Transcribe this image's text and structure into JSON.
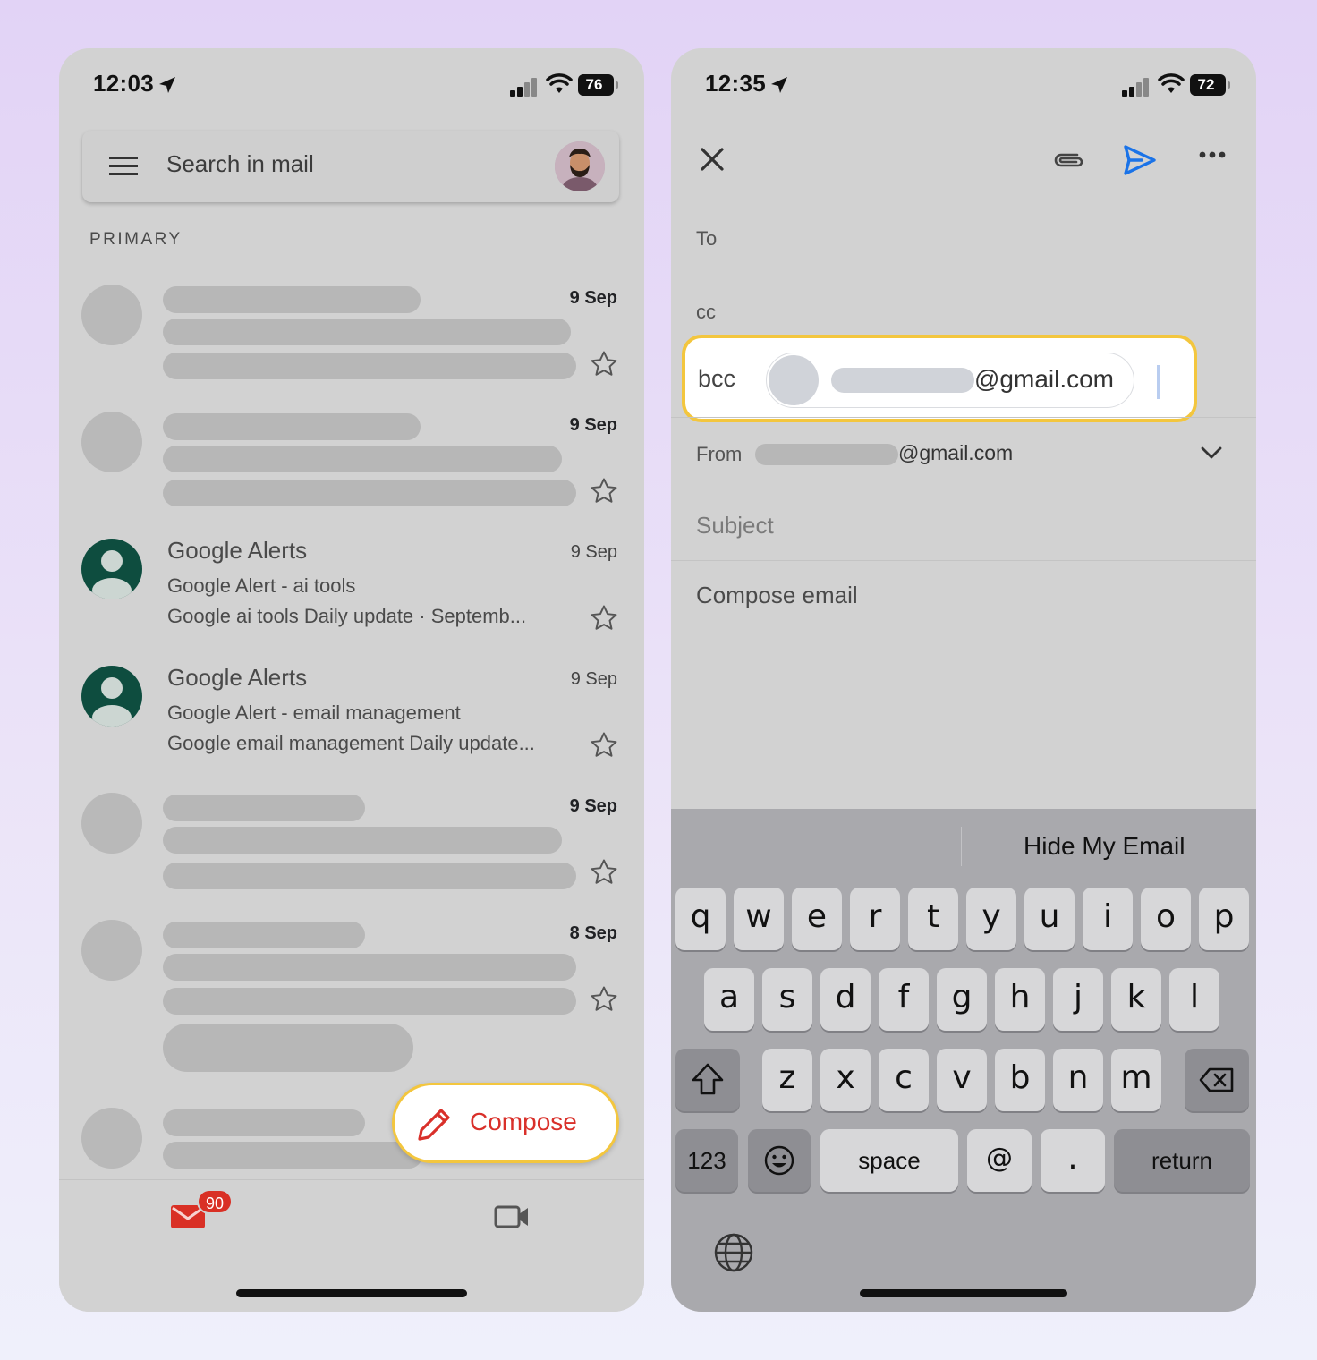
{
  "left": {
    "status": {
      "time": "12:03",
      "battery": "76"
    },
    "search": {
      "placeholder": "Search in mail"
    },
    "section_label": "PRIMARY",
    "rows": [
      {
        "date": "9 Sep"
      },
      {
        "date": "9 Sep"
      },
      {
        "sender": "Google Alerts",
        "date": "9 Sep",
        "subject": "Google Alert - ai tools",
        "snippet": "Google ai tools Daily update  ·  Septemb..."
      },
      {
        "sender": "Google Alerts",
        "date": "9 Sep",
        "subject": "Google Alert - email management",
        "snippet": "Google email management Daily update..."
      },
      {
        "date": "9 Sep"
      },
      {
        "date": "8 Sep"
      }
    ],
    "compose_label": "Compose",
    "mail_badge": "90"
  },
  "right": {
    "status": {
      "time": "12:35",
      "battery": "72"
    },
    "fields": {
      "to_label": "To",
      "cc_label": "cc",
      "bcc_label": "bcc",
      "bcc_chip_domain": "@gmail.com",
      "from_label": "From",
      "from_domain": "@gmail.com",
      "subject_placeholder": "Subject",
      "body_placeholder": "Compose email"
    },
    "keyboard": {
      "suggestion": "Hide My Email",
      "row1": [
        "q",
        "w",
        "e",
        "r",
        "t",
        "y",
        "u",
        "i",
        "o",
        "p"
      ],
      "row2": [
        "a",
        "s",
        "d",
        "f",
        "g",
        "h",
        "j",
        "k",
        "l"
      ],
      "row3": [
        "z",
        "x",
        "c",
        "v",
        "b",
        "n",
        "m"
      ],
      "numbers_key": "123",
      "space_key": "space",
      "at_key": "@",
      "period_key": ".",
      "return_key": "return"
    }
  },
  "colors": {
    "accent_highlight": "#f3c63e",
    "compose_red": "#d9302a",
    "send_blue": "#1a73e8",
    "avatar_green": "#0e4d3f"
  }
}
